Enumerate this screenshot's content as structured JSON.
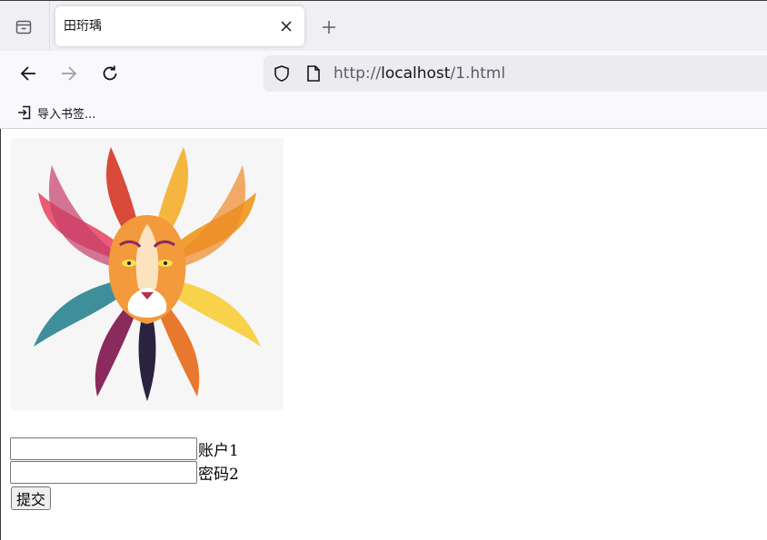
{
  "browser": {
    "tab": {
      "title": "田珩瑀"
    },
    "url": {
      "scheme": "http://",
      "host": "localhost",
      "path": "/1.html"
    },
    "bookmarks": {
      "import_label": "导入书签..."
    }
  },
  "page": {
    "form": {
      "account_label": "账户1",
      "account_value": "",
      "password_label": "密码2",
      "password_value": "",
      "submit_label": "提交"
    }
  },
  "icons": {
    "tab_overview": "tab-overview-icon",
    "close": "close-icon",
    "new_tab": "plus-icon",
    "back": "arrow-left-icon",
    "forward": "arrow-right-icon",
    "reload": "reload-icon",
    "shield": "shield-icon",
    "page": "page-icon",
    "import": "import-icon"
  },
  "colors": {
    "tabbar_bg": "#f0f0f4",
    "toolbar_bg": "#f9f9fb",
    "urlbar_bg": "#ececf0",
    "text": "#15141a"
  }
}
